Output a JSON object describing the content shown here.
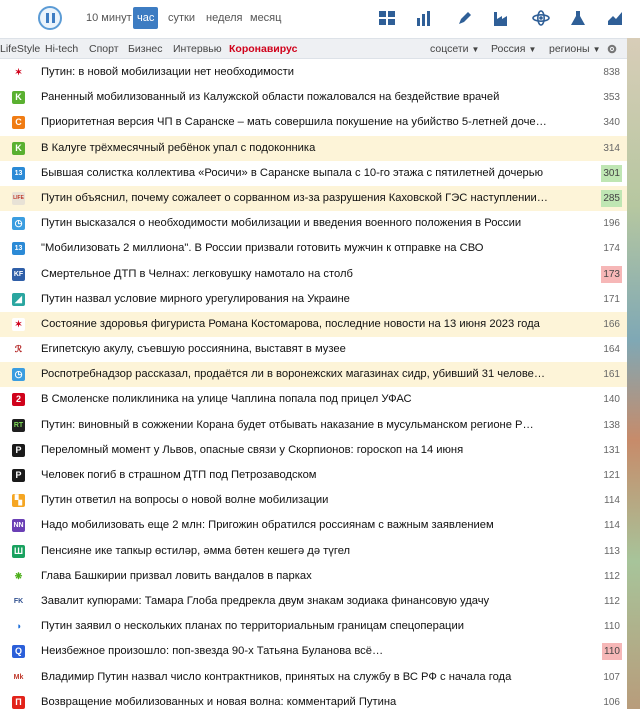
{
  "toolbar": {
    "periods": [
      "10 минут",
      "час",
      "сутки",
      "неделя",
      "месяц"
    ],
    "active_period": "час",
    "icons": [
      "dashboard-icon",
      "bar-chart-icon",
      "pen-icon",
      "factory-icon",
      "atom-icon",
      "flask-icon",
      "line-chart-icon"
    ]
  },
  "categories": [
    "LifeStyle",
    "Hi-tech",
    "Спорт",
    "Бизнес",
    "Интервью",
    "Коронавирус"
  ],
  "highlight_category": "Коронавирус",
  "dropdowns": [
    "соцсети",
    "Россия",
    "регионы"
  ],
  "accent_color": "#3d7cc2",
  "news": [
    {
      "title": "Путин: в новой мобилизации нет необходимости",
      "count": "838",
      "icon_color": "#ffffff",
      "glyph": "✶",
      "glyph_color": "#d0021b",
      "hl": false,
      "badge": ""
    },
    {
      "title": "Раненный мобилизованный из Калужской области пожаловался на бездействие врачей",
      "count": "353",
      "icon_color": "#5ab031",
      "glyph": "K",
      "glyph_color": "#ffffff",
      "hl": false,
      "badge": ""
    },
    {
      "title": "Приоритетная версия ЧП в Саранске – мать совершила покушение на убийство 5-летней доче…",
      "count": "340",
      "icon_color": "#f07c14",
      "glyph": "С",
      "glyph_color": "#ffffff",
      "hl": false,
      "badge": ""
    },
    {
      "title": "В Калуге трёхмесячный ребёнок упал с подоконника",
      "count": "314",
      "icon_color": "#5ab031",
      "glyph": "K",
      "glyph_color": "#ffffff",
      "hl": true,
      "badge": ""
    },
    {
      "title": "Бывшая солистка коллектива «Росичи» в Саранске выпала с 10-го этажа с пятилетней дочерью",
      "count": "301",
      "icon_color": "#2b8ad6",
      "glyph": "13",
      "glyph_color": "#ffffff",
      "hl": false,
      "badge": "green"
    },
    {
      "title": "Путин объяснил, почему сожалеет о сорванном из-за разрушения Каховской ГЭС наступлении…",
      "count": "285",
      "icon_color": "#e8e2d6",
      "glyph": "LIFE",
      "glyph_color": "#c0392b",
      "hl": true,
      "badge": "green"
    },
    {
      "title": "Путин высказался о необходимости мобилизации и введения военного положения в России",
      "count": "196",
      "icon_color": "#3b9de0",
      "glyph": "◷",
      "glyph_color": "#ffffff",
      "hl": false,
      "badge": ""
    },
    {
      "title": "\"Мобилизовать 2 миллиона\". В России призвали готовить мужчин к отправке на СВО",
      "count": "174",
      "icon_color": "#2b8ad6",
      "glyph": "13",
      "glyph_color": "#ffffff",
      "hl": false,
      "badge": ""
    },
    {
      "title": "Смертельное ДТП в Челнах: легковушку намотало на столб",
      "count": "173",
      "icon_color": "#2f5fa8",
      "glyph": "KF",
      "glyph_color": "#ffffff",
      "hl": false,
      "badge": "red"
    },
    {
      "title": "Путин назвал условие мирного урегулирования на Украине",
      "count": "171",
      "icon_color": "#2aa6a0",
      "glyph": "◢",
      "glyph_color": "#ffffff",
      "hl": false,
      "badge": ""
    },
    {
      "title": "Состояние здоровья фигуриста Романа Костомарова, последние новости на 13 июня 2023 года",
      "count": "166",
      "icon_color": "#ffffff",
      "glyph": "✶",
      "glyph_color": "#d0021b",
      "hl": true,
      "badge": ""
    },
    {
      "title": "Египетскую акулу, съевшую россиянина, выставят в музее",
      "count": "164",
      "icon_color": "#ffffff",
      "glyph": "ℛ",
      "glyph_color": "#b22222",
      "hl": false,
      "badge": ""
    },
    {
      "title": "Роспотребнадзор рассказал, продаётся ли в воронежских магазинах сидр, убивший 31 челове…",
      "count": "161",
      "icon_color": "#3b9de0",
      "glyph": "◷",
      "glyph_color": "#ffffff",
      "hl": true,
      "badge": ""
    },
    {
      "title": "В Смоленске поликлиника на улице Чаплина попала под прицел УФАС",
      "count": "140",
      "icon_color": "#d0021b",
      "glyph": "2",
      "glyph_color": "#ffffff",
      "hl": false,
      "badge": ""
    },
    {
      "title": "Путин: виновный в сожжении Корана будет отбывать наказание в мусульманском регионе Р…",
      "count": "138",
      "icon_color": "#1f1f1f",
      "glyph": "RT",
      "glyph_color": "#7ed957",
      "hl": false,
      "badge": ""
    },
    {
      "title": "Переломный момент у Львов, опасные связи у Скорпионов: гороскоп на 14 июня",
      "count": "131",
      "icon_color": "#1a1a1a",
      "glyph": "P",
      "glyph_color": "#ffffff",
      "hl": false,
      "badge": ""
    },
    {
      "title": "Человек погиб в страшном ДТП под Петрозаводском",
      "count": "121",
      "icon_color": "#1a1a1a",
      "glyph": "P",
      "glyph_color": "#ffffff",
      "hl": false,
      "badge": ""
    },
    {
      "title": "Путин ответил на вопросы о новой волне мобилизации",
      "count": "114",
      "icon_color": "#f5a623",
      "glyph": "▚",
      "glyph_color": "#ffffff",
      "hl": false,
      "badge": ""
    },
    {
      "title": "Надо мобилизовать еще 2 млн: Пригожин обратился россиянам с важным заявлением",
      "count": "114",
      "icon_color": "#6a3fb5",
      "glyph": "NN",
      "glyph_color": "#ffffff",
      "hl": false,
      "badge": ""
    },
    {
      "title": "Пенсияне ике тапкыр өстиләр, әмма бөтен кешегә дә түгел",
      "count": "113",
      "icon_color": "#1aa260",
      "glyph": "Ш",
      "glyph_color": "#ffffff",
      "hl": false,
      "badge": ""
    },
    {
      "title": "Глава Башкирии призвал ловить вандалов в парках",
      "count": "112",
      "icon_color": "#ffffff",
      "glyph": "❋",
      "glyph_color": "#4caf1a",
      "hl": false,
      "badge": ""
    },
    {
      "title": "Завалит купюрами: Тамара Глоба предрекла двум знакам зодиака финансовую удачу",
      "count": "112",
      "icon_color": "#ffffff",
      "glyph": "FK",
      "glyph_color": "#2f4f8f",
      "hl": false,
      "badge": ""
    },
    {
      "title": "Путин заявил о нескольких планах по территориальным границам спецоперации",
      "count": "110",
      "icon_color": "#ffffff",
      "glyph": "◑",
      "glyph_color": "#1e6fd9",
      "hl": false,
      "badge": ""
    },
    {
      "title": "Неизбежное произошло: поп-звезда 90-х Татьяна Буланова всё…",
      "count": "110",
      "icon_color": "#2b5fd9",
      "glyph": "Q",
      "glyph_color": "#ffffff",
      "hl": false,
      "badge": "red"
    },
    {
      "title": "Владимир Путин назвал число контрактников, принятых на службу в ВС РФ с начала года",
      "count": "107",
      "icon_color": "#ffffff",
      "glyph": "Mk",
      "glyph_color": "#c0392b",
      "hl": false,
      "badge": ""
    },
    {
      "title": "Возвращение мобилизованных и новая волна: комментарий Путина",
      "count": "106",
      "icon_color": "#e2231a",
      "glyph": "П",
      "glyph_color": "#ffffff",
      "hl": false,
      "badge": ""
    }
  ]
}
